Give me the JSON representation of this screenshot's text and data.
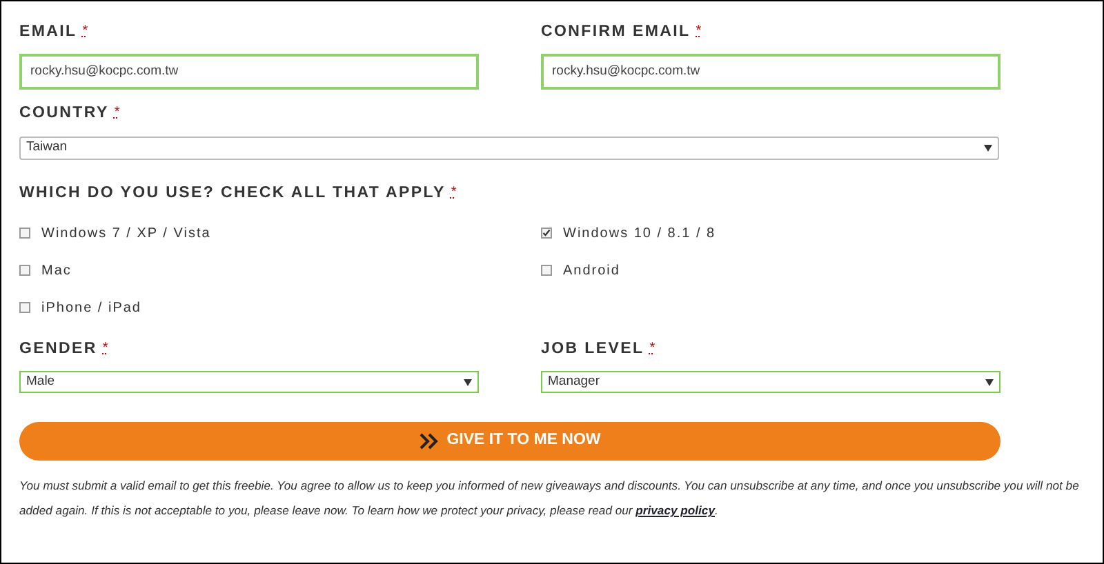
{
  "fields_top": [
    {
      "label": "EMAIL",
      "required_mark": "*",
      "value": "rocky.hsu@kocpc.com.tw",
      "valid": true
    },
    {
      "label": "CONFIRM EMAIL",
      "required_mark": "*",
      "value": "rocky.hsu@kocpc.com.tw",
      "valid": true
    }
  ],
  "country": {
    "label": "COUNTRY",
    "required_mark": "*",
    "value": "Taiwan",
    "valid": false
  },
  "devices": {
    "label": "WHICH DO YOU USE? CHECK ALL THAT APPLY",
    "required_mark": "*",
    "options": [
      {
        "label": "Windows 7 / XP / Vista",
        "checked": false
      },
      {
        "label": "Windows 10 / 8.1 / 8",
        "checked": true
      },
      {
        "label": "Mac",
        "checked": false
      },
      {
        "label": "Android",
        "checked": false
      },
      {
        "label": "iPhone / iPad",
        "checked": false
      }
    ]
  },
  "selects": [
    {
      "label": "GENDER",
      "required_mark": "*",
      "value": "Male",
      "valid": true
    },
    {
      "label": "JOB LEVEL",
      "required_mark": "*",
      "value": "Manager",
      "valid": true
    }
  ],
  "submit": {
    "label": "GIVE IT TO ME NOW"
  },
  "disclaimer": {
    "text": "You must submit a valid email to get this freebie. You agree to allow us to keep you informed of new giveaways and discounts. You can unsubscribe at any time, and once you unsubscribe you will not be added again. If this is not acceptable to you, please leave now. To learn how we protect your privacy, please read our ",
    "link": "privacy policy",
    "end": "."
  }
}
